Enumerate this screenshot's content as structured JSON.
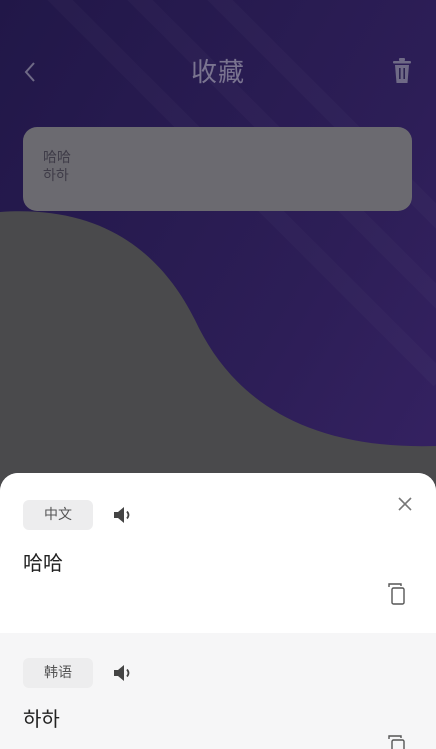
{
  "header": {
    "title": "收藏"
  },
  "favorites": [
    {
      "source": "哈哈",
      "target": "하하"
    }
  ],
  "sheet": {
    "source": {
      "lang": "中文",
      "text": "哈哈"
    },
    "target": {
      "lang": "韩语",
      "text": "하하"
    }
  },
  "icons": {
    "back": "chevron-left-icon",
    "trash": "trash-icon",
    "close": "close-icon",
    "speaker": "speaker-icon",
    "copy": "copy-icon"
  },
  "colors": {
    "accent": "#3b2a6b",
    "sheet_bg": "#ffffff",
    "chip_bg": "#ededee"
  }
}
